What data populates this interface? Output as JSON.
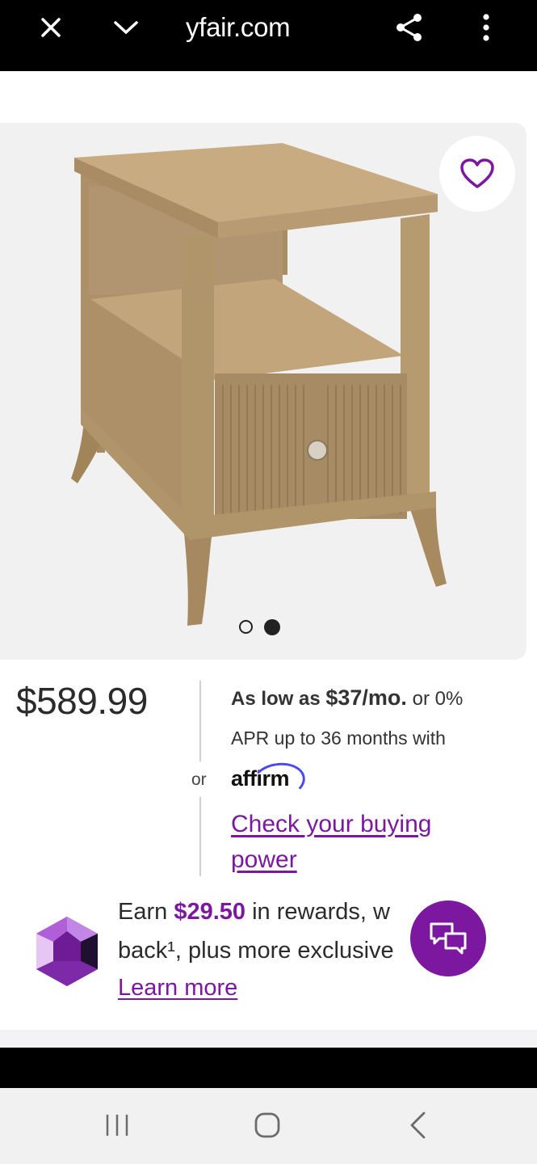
{
  "browser": {
    "url": "yfair.com",
    "icons": [
      "close-icon",
      "chevron-down-icon",
      "share-icon",
      "more-vert-icon"
    ]
  },
  "product": {
    "image_dots": {
      "count": 2,
      "active_index": 1
    },
    "price": "$589.99"
  },
  "financing": {
    "line1_prefix": "As low as ",
    "line1_amount": "$37/mo.",
    "line1_suffix": " or 0%",
    "line2": "APR up to 36 months with",
    "or_label": "or",
    "affirm_logo": "affirm",
    "check_link": "Check your buying power"
  },
  "rewards": {
    "earn_prefix": "Earn ",
    "amount": "$29.50",
    "earn_suffix": " in rewards, w",
    "line2": "back¹, plus more exclusive",
    "learn_more": "Learn more"
  },
  "colors": {
    "accent": "#7b189f",
    "image_bg": "#f2f1f2",
    "affirm_arc": "#4a4af4"
  }
}
